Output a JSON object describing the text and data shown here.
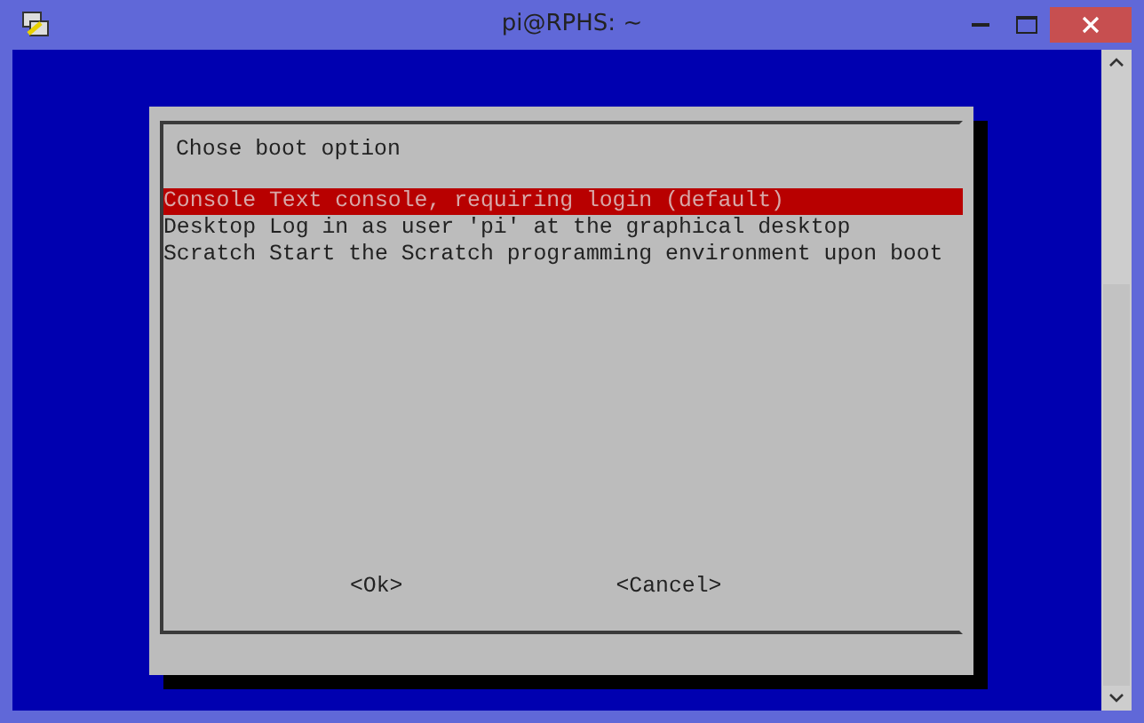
{
  "window": {
    "title": "pi@RPHS: ~"
  },
  "dialog": {
    "title": "Chose boot option",
    "options": [
      {
        "label": "Console Text console, requiring login (default)",
        "selected": true
      },
      {
        "label": "Desktop Log in as user 'pi' at the graphical desktop",
        "selected": false
      },
      {
        "label": "Scratch Start the Scratch programming environment upon boot",
        "selected": false
      }
    ],
    "buttons": [
      "<Ok>",
      "<Cancel>"
    ]
  }
}
